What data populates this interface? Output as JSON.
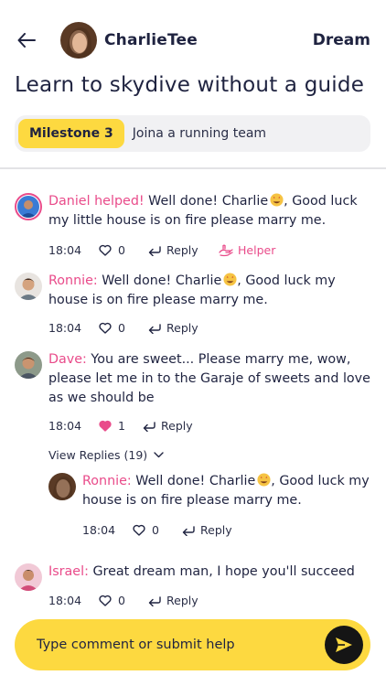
{
  "header": {
    "username": "CharlieTee",
    "dream_link": "Dream",
    "title": "Learn to skydive without a guide"
  },
  "milestone": {
    "chip": "Milestone 3",
    "text": "Joina a running team"
  },
  "comments": [
    {
      "name": "Daniel helped!",
      "lines": [
        "Well done! Charlie",
        ", Good luck",
        "my little house is on fire please marry me."
      ],
      "time": "18:04",
      "likes": "0",
      "reply": "Reply",
      "helper": "Helper"
    },
    {
      "name": "Ronnie:",
      "lines": [
        "Well done! Charlie",
        ", Good luck my",
        "house is on fire please marry me."
      ],
      "time": "18:04",
      "likes": "0",
      "reply": "Reply"
    },
    {
      "name": "Dave:",
      "lines": [
        "You are sweet... Please marry me, wow,",
        "please let me in to the Garaje of sweets and love",
        "as we should be"
      ],
      "time": "18:04",
      "likes": "1",
      "reply": "Reply",
      "liked": true
    },
    {
      "name": "Ronnie:",
      "lines": [
        "Well done! Charlie",
        ", Good luck my",
        "house is on fire please marry me."
      ],
      "time": "18:04",
      "likes": "0",
      "reply": "Reply"
    },
    {
      "name": "Israel:",
      "lines": [
        "Great dream man, I hope you'll succeed"
      ],
      "time": "18:04",
      "likes": "0",
      "reply": "Reply"
    }
  ],
  "view_replies": "View Replies (19)",
  "composer": {
    "placeholder": "Type comment or submit help"
  },
  "icons": {
    "back": "arrow-left-icon",
    "like": "heart-icon",
    "reply": "reply-arrow-icon",
    "helper": "helping-hand-icon",
    "chevron": "chevron-down-icon",
    "send": "send-icon",
    "emoji": "star-struck-emoji"
  },
  "colors": {
    "accent": "#fdd940",
    "name": "#e94b8a",
    "text": "#1f2340",
    "send": "#151515"
  }
}
